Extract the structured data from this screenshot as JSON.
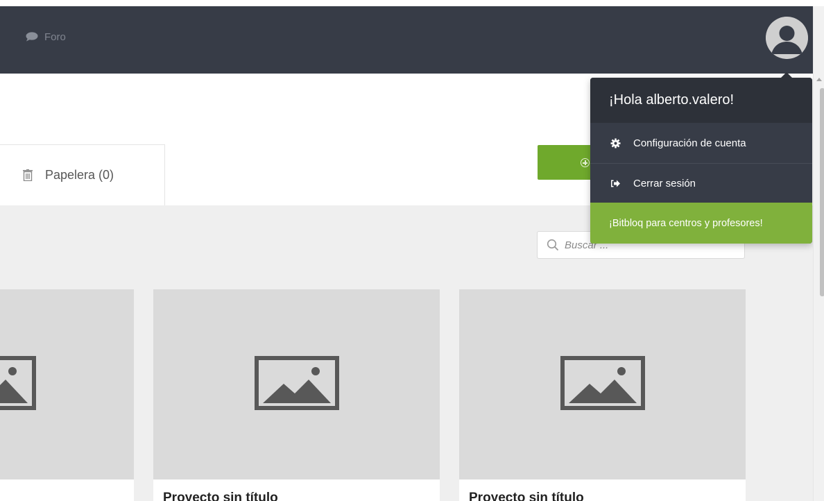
{
  "navbar": {
    "forum_label": "Foro"
  },
  "tabs": {
    "trash_label": "Papelera (0)"
  },
  "search": {
    "placeholder": "Buscar ..."
  },
  "projects": [
    {
      "title": ""
    },
    {
      "title": "Proyecto sin título"
    },
    {
      "title": "Proyecto sin título"
    }
  ],
  "user_menu": {
    "greeting": "¡Hola alberto.valero!",
    "account_settings": "Configuración de cuenta",
    "logout": "Cerrar sesión",
    "promo": "¡Bitbloq para centros y profesores!"
  },
  "icons": {
    "forum": "chat-bubble-icon",
    "avatar": "user-avatar-icon",
    "trash": "trash-icon",
    "new": "plus-circle-icon",
    "search": "search-icon",
    "settings": "gear-icon",
    "logout": "sign-out-icon",
    "placeholder_image": "image-placeholder-icon"
  },
  "colors": {
    "navbar": "#373c47",
    "accent_green": "#80b13c",
    "button_green": "#6fa92c",
    "content_bg": "#efefef",
    "thumb_bg": "#dadada"
  }
}
